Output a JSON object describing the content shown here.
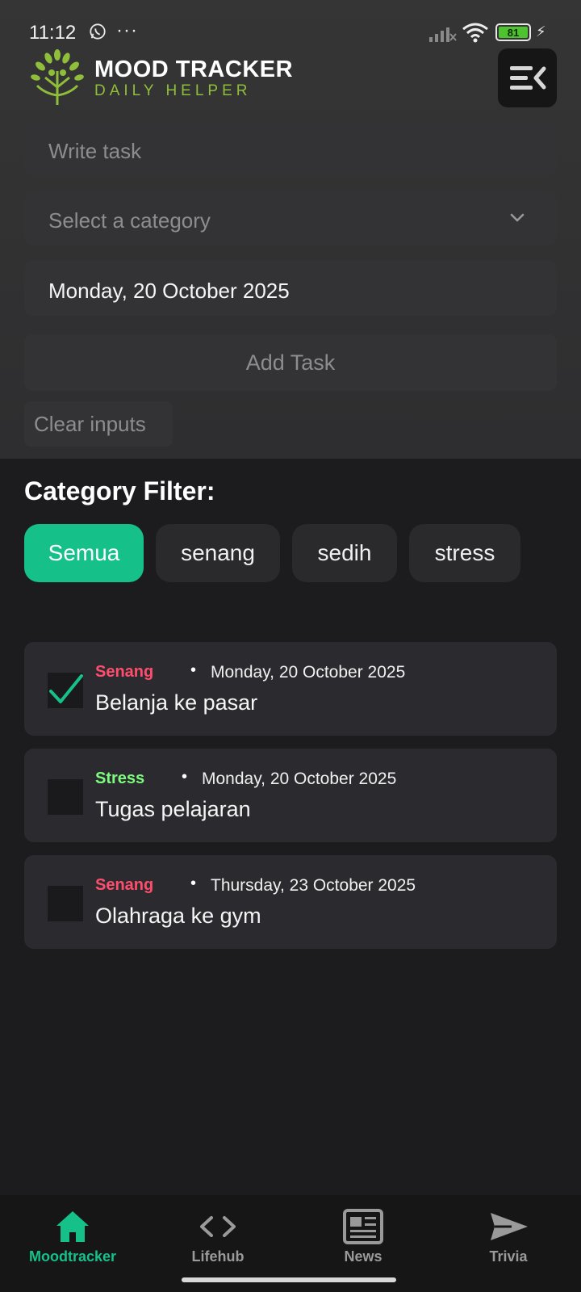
{
  "status_bar": {
    "time": "11:12",
    "battery": "81"
  },
  "brand": {
    "title": "MOOD TRACKER",
    "subtitle": "DAILY HELPER"
  },
  "form": {
    "task_placeholder": "Write task",
    "category_placeholder": "Select a category",
    "date_value": "Monday, 20 October 2025",
    "add_label": "Add Task",
    "clear_label": "Clear inputs"
  },
  "filter": {
    "title": "Category Filter:",
    "chips": [
      "Semua",
      "senang",
      "sedih",
      "stress"
    ],
    "active": "Semua"
  },
  "tasks": [
    {
      "category": "Senang",
      "date": "Monday, 20 October 2025",
      "title": "Belanja ke pasar",
      "done": true
    },
    {
      "category": "Stress",
      "date": "Monday, 20 October 2025",
      "title": "Tugas pelajaran",
      "done": false
    },
    {
      "category": "Senang",
      "date": "Thursday, 23 October 2025",
      "title": "Olahraga ke gym",
      "done": false
    }
  ],
  "bullet": "•",
  "nav": [
    {
      "label": "Moodtracker",
      "icon": "home-icon",
      "active": true
    },
    {
      "label": "Lifehub",
      "icon": "code-icon",
      "active": false
    },
    {
      "label": "News",
      "icon": "newspaper-icon",
      "active": false
    },
    {
      "label": "Trivia",
      "icon": "send-icon",
      "active": false
    }
  ],
  "colors": {
    "accent": "#16c089",
    "senang": "#ff4d6d",
    "stress": "#7dfc7d",
    "brand_sub": "#8fbf3a"
  }
}
